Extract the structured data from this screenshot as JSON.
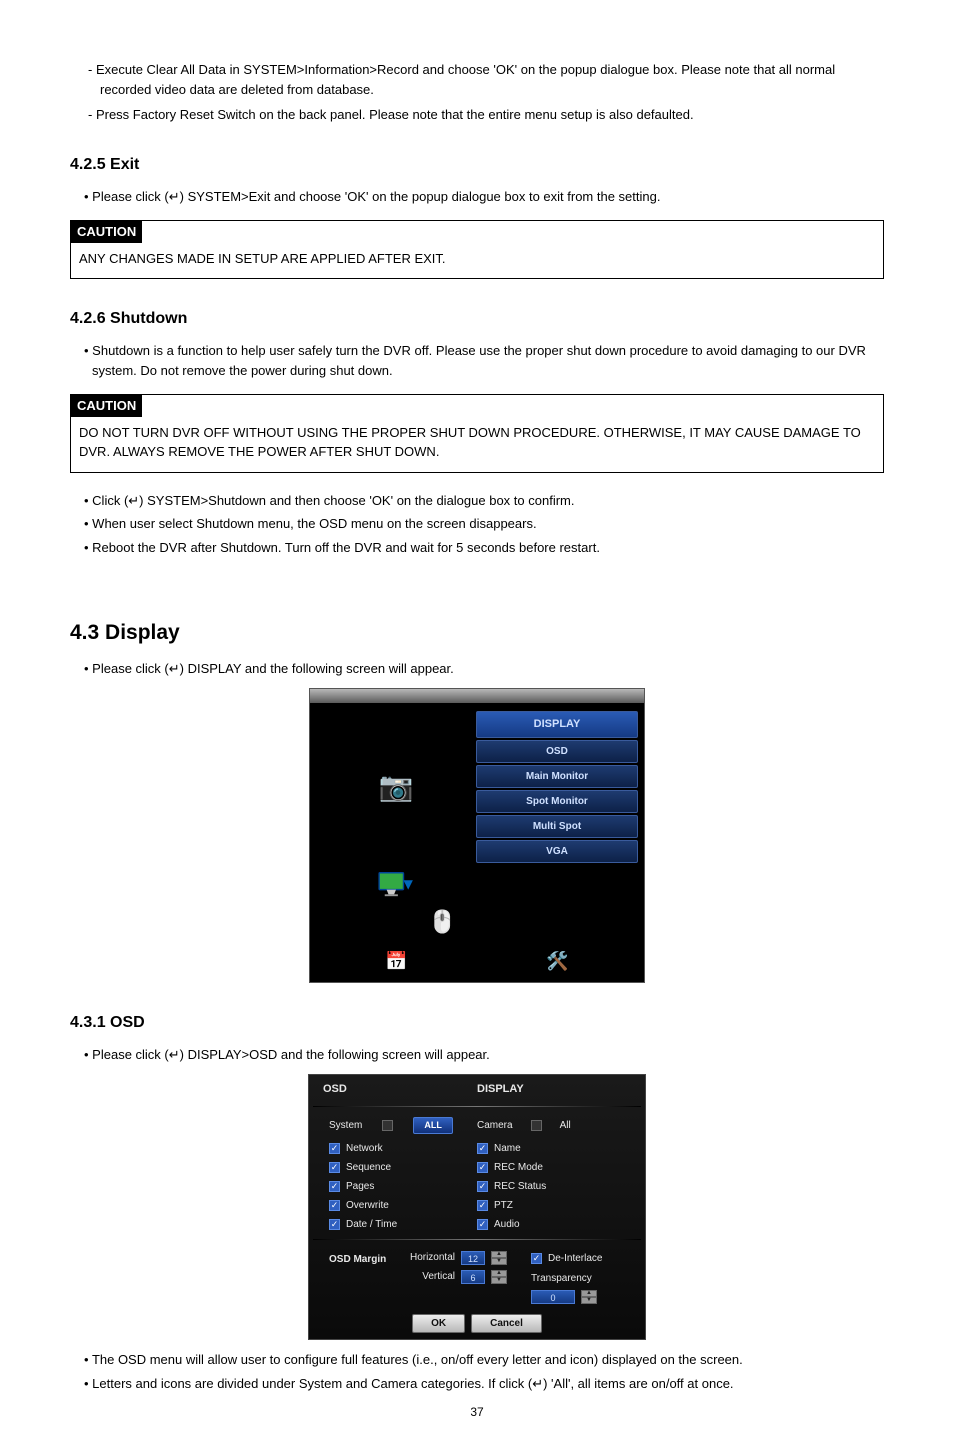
{
  "intro_bullets": {
    "b1": "Execute Clear All Data in SYSTEM>Information>Record and choose 'OK' on the popup dialogue box. Please note that all normal recorded video data are deleted from database.",
    "b2": "Press Factory Reset Switch on the back panel. Please note that the entire menu setup is also defaulted."
  },
  "s425": {
    "heading": "4.2.5   Exit",
    "p1": "Please click (↵) SYSTEM>Exit and choose 'OK' on the popup dialogue box to exit from the setting.",
    "caution_label": "CAUTION",
    "caution_body": "ANY CHANGES MADE IN SETUP ARE APPLIED AFTER EXIT."
  },
  "s426": {
    "heading": "4.2.6   Shutdown",
    "p1": "Shutdown is a function to help user safely turn the DVR off. Please use the proper shut down procedure to avoid damaging to our DVR system. Do not remove the power during shut down.",
    "caution_label": "CAUTION",
    "caution_body": "DO NOT TURN DVR OFF WITHOUT USING THE PROPER SHUT DOWN PROCEDURE. OTHERWISE, IT MAY CAUSE DAMAGE TO DVR. ALWAYS REMOVE THE POWER AFTER SHUT DOWN.",
    "p2": "Click (↵) SYSTEM>Shutdown and then choose 'OK' on the dialogue box to confirm.",
    "p3": "When user select Shutdown menu, the OSD menu on the screen disappears.",
    "p4": "Reboot the DVR after Shutdown. Turn off the DVR and wait for 5 seconds before restart."
  },
  "s43": {
    "heading": "4.3  Display",
    "p1": "Please click (↵) DISPLAY and the following screen will appear."
  },
  "dvr": {
    "header": "DISPLAY",
    "items": [
      "OSD",
      "Main Monitor",
      "Spot Monitor",
      "Multi Spot",
      "VGA"
    ]
  },
  "s431": {
    "heading": "4.3.1   OSD",
    "p1": "Please click (↵) DISPLAY>OSD and the following screen will appear.",
    "p2": "The OSD menu will allow user to configure full features (i.e., on/off every letter and icon) displayed on the screen.",
    "p3": "Letters and icons are divided under System and Camera categories. If click (↵) 'All', all items are on/off at once."
  },
  "osd": {
    "head_left": "OSD",
    "head_mid": "DISPLAY",
    "sys_label": "System",
    "all_btn": "ALL",
    "cam_label": "Camera",
    "cam_all": "All",
    "sys_items": [
      "Network",
      "Sequence",
      "Pages",
      "Overwrite",
      "Date / Time"
    ],
    "cam_items": [
      "Name",
      "REC Mode",
      "REC Status",
      "PTZ",
      "Audio"
    ],
    "margin_label": "OSD Margin",
    "horiz": "Horizontal",
    "vert": "Vertical",
    "hval": "12",
    "vval": "6",
    "deint": "De-Interlace",
    "trans": "Transparency",
    "tval": "0",
    "ok": "OK",
    "cancel": "Cancel"
  },
  "page": "37"
}
